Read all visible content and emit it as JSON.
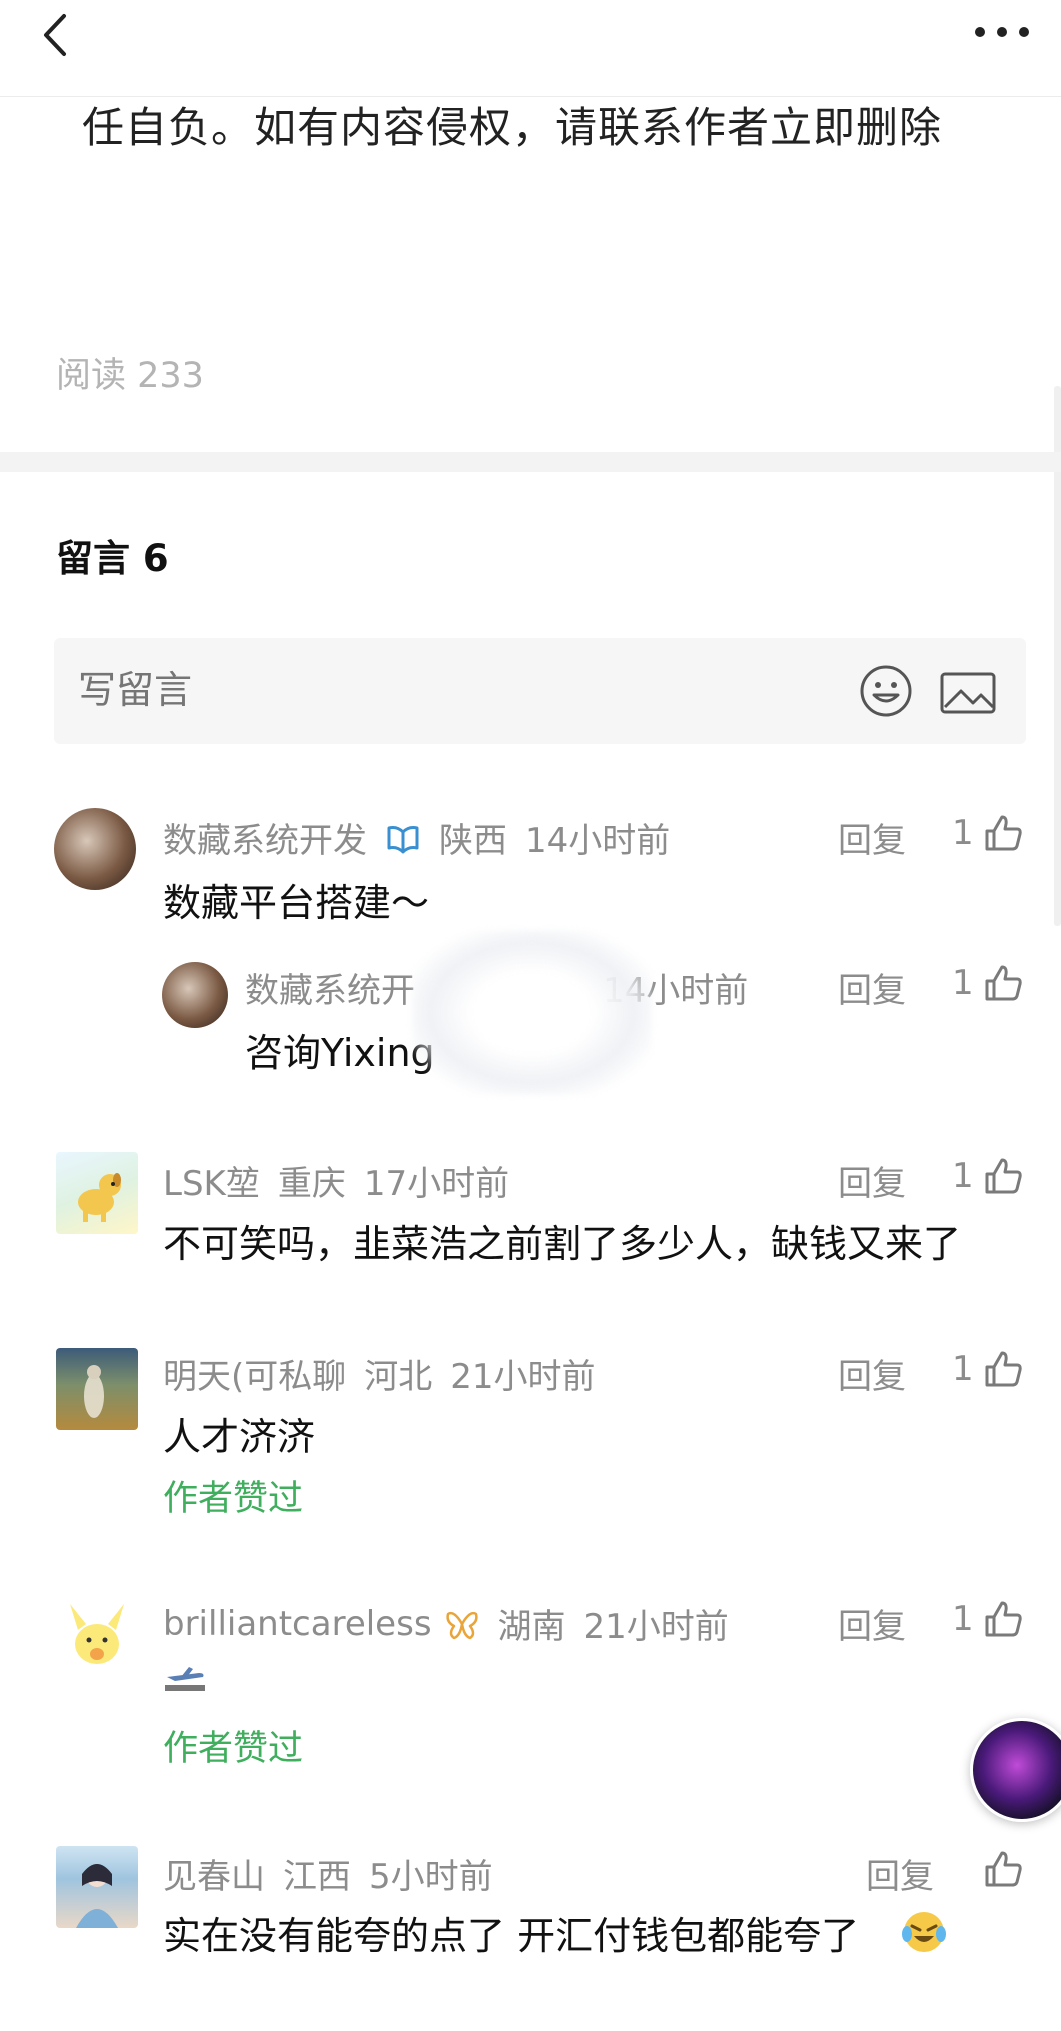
{
  "article": {
    "tail_text": "任自负。如有内容侵权，请联系作者立即删除",
    "read_count": "阅读 233"
  },
  "comments_section": {
    "title": "留言 6",
    "input_placeholder": "写留言",
    "reply_label": "回复",
    "author_liked_label": "作者赞过",
    "accent_green": "#3fae5d",
    "comments": [
      {
        "nickname": "数藏系统开发",
        "badge_icon": "book-badge-icon",
        "region": "陕西",
        "time": "14小时前",
        "likes": "1",
        "text": "数藏平台搭建～",
        "reply": {
          "nickname": "数藏系统开",
          "time": "14小时前",
          "likes": "1",
          "text": "咨询Yixing"
        }
      },
      {
        "nickname": "LSK堃",
        "region": "重庆",
        "time": "17小时前",
        "likes": "1",
        "text": "不可笑吗，韭菜浩之前割了多少人，缺钱又来了"
      },
      {
        "nickname": "明天(可私聊",
        "region": "河北",
        "time": "21小时前",
        "likes": "1",
        "text": "人才济济",
        "author_liked": true
      },
      {
        "nickname": "brilliantcareless",
        "badge_icon": "butterfly-badge-icon",
        "region": "湖南",
        "time": "21小时前",
        "likes": "1",
        "text_icon": "airplane-emoji-icon",
        "author_liked": true
      },
      {
        "nickname": "见春山",
        "region": "江西",
        "time": "5小时前",
        "likes": "",
        "text": "实在没有能夸的点了 开汇付钱包都能夸了",
        "text_icon": "crying-laughing-emoji-icon"
      }
    ]
  }
}
